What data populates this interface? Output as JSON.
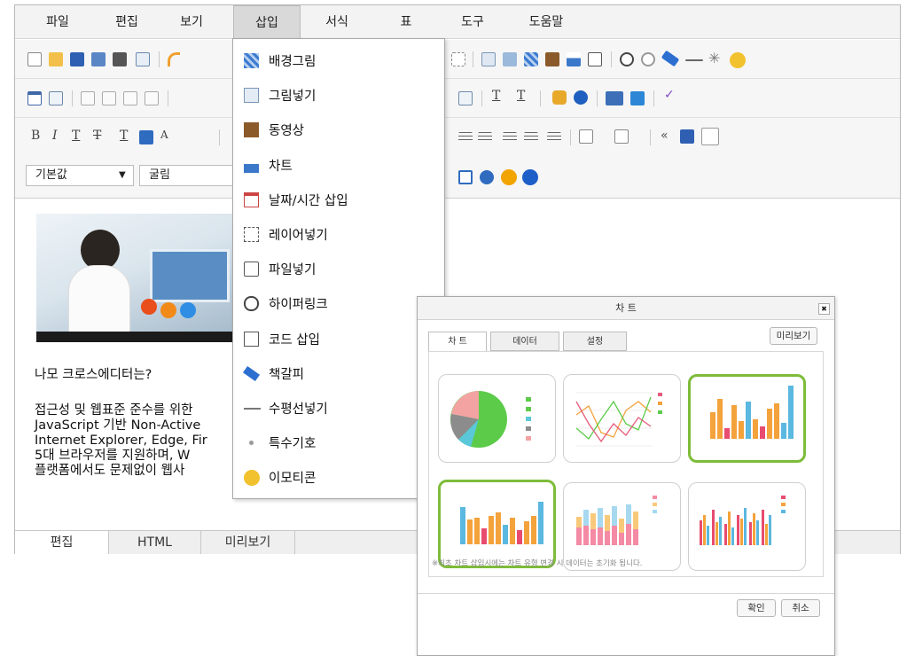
{
  "menu": [
    "파일",
    "편집",
    "보기",
    "삽입",
    "서식",
    "표",
    "도구",
    "도움말"
  ],
  "font_row": {
    "style": "기본값",
    "font": "굴림"
  },
  "content": {
    "heading": "나모 크로스에디터는?",
    "lines": [
      "접근성 및 웹표준 준수를 위한",
      "JavaScript 기반 Non-Active",
      "Internet Explorer, Edge, Fir",
      "5대 브라우저를 지원하며, W",
      "플랫폼에서도 문제없이 웹사"
    ]
  },
  "bottom_tabs": [
    "편집",
    "HTML",
    "미리보기"
  ],
  "insert_menu": [
    {
      "label": "배경그림",
      "icon": "background-image-icon"
    },
    {
      "label": "그림넣기",
      "icon": "image-icon"
    },
    {
      "label": "동영상",
      "icon": "video-icon"
    },
    {
      "label": "차트",
      "icon": "chart-icon"
    },
    {
      "label": "날짜/시간 삽입",
      "icon": "calendar-icon"
    },
    {
      "label": "레이어넣기",
      "icon": "layer-icon"
    },
    {
      "label": "파일넣기",
      "icon": "file-icon"
    },
    {
      "label": "하이퍼링크",
      "icon": "hyperlink-icon"
    },
    {
      "label": "코드 삽입",
      "icon": "code-icon"
    },
    {
      "label": "책갈피",
      "icon": "bookmark-icon"
    },
    {
      "label": "수평선넣기",
      "icon": "horizontal-line-icon"
    },
    {
      "label": "특수기호",
      "icon": "special-character-icon"
    },
    {
      "label": "이모티콘",
      "icon": "emoticon-icon"
    }
  ],
  "chart_dialog": {
    "title": "차 트",
    "tabs": [
      "차 트",
      "데이터",
      "설정"
    ],
    "preview_label": "미리보기",
    "note": "※최초 차트 삽입시에는 차트 유형 변경 시 데이터는 초기화 됩니다.",
    "ok_label": "확인",
    "cancel_label": "취소",
    "close_glyph": "✖"
  },
  "colors": {
    "accent_green": "#7ebc3a",
    "toolbar_bg": "#f6f6f6",
    "menu_active": "#d9d9d9"
  }
}
